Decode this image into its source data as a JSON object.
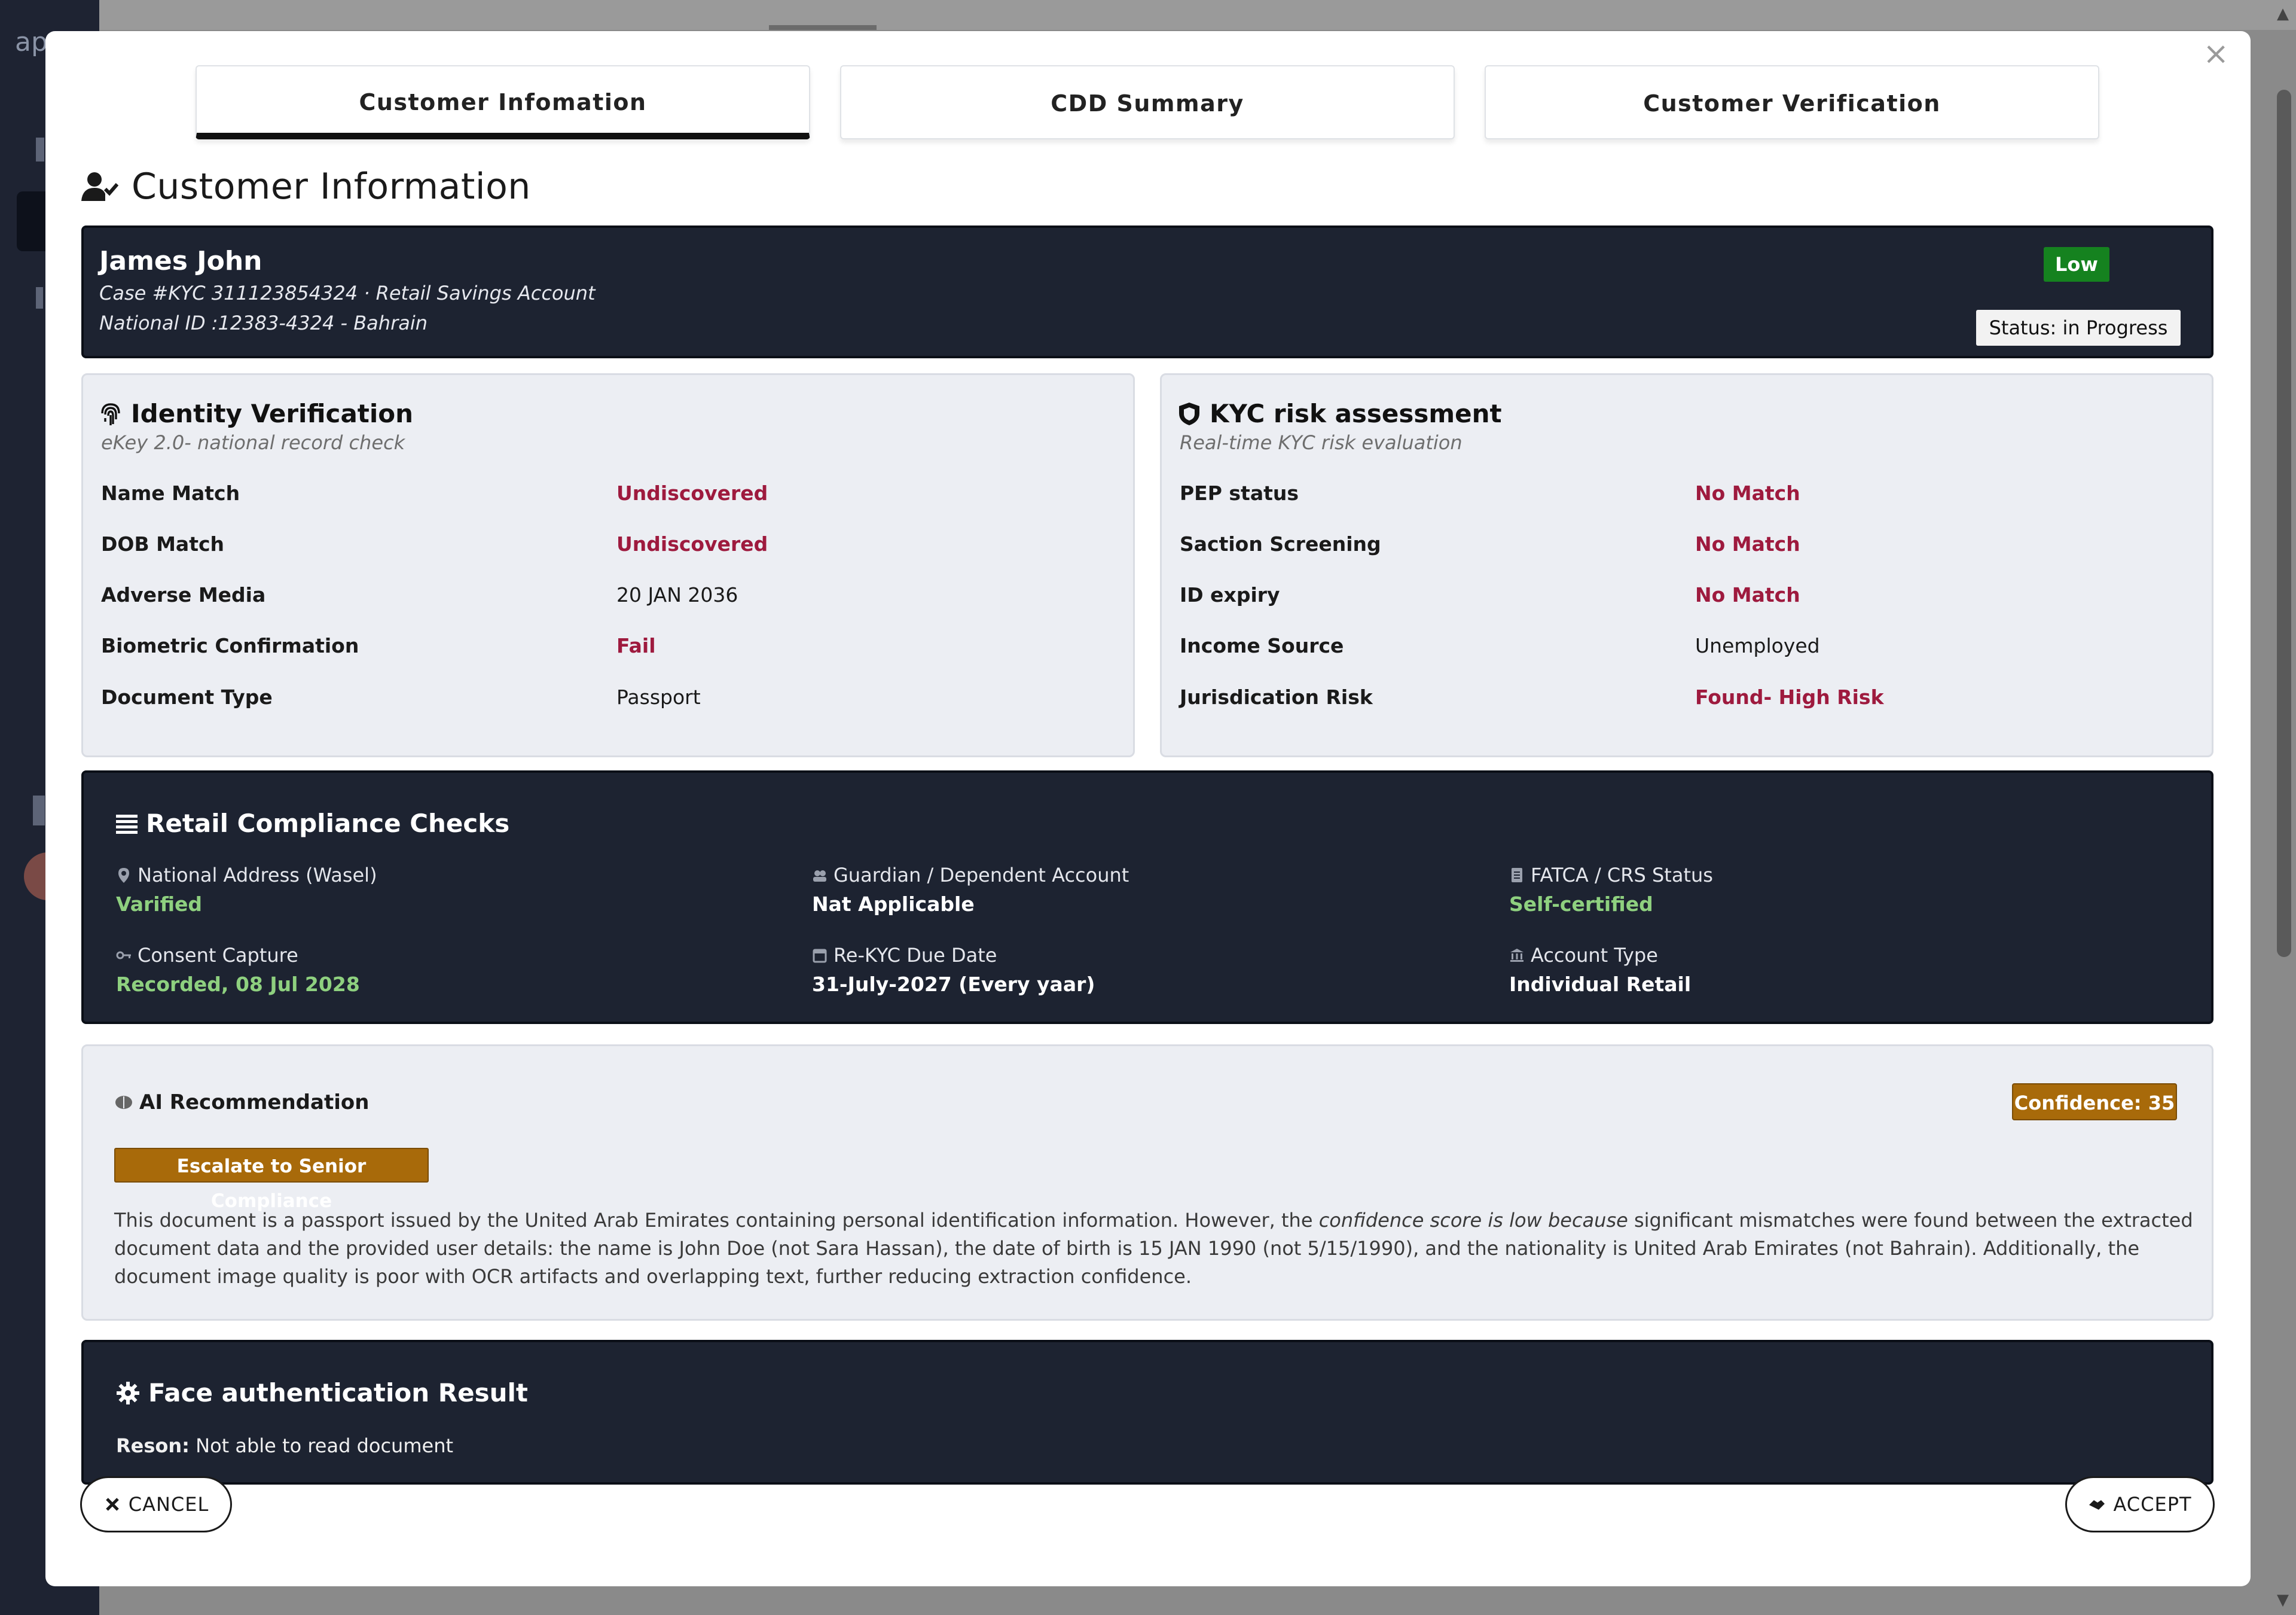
{
  "background": {
    "app_logo_fragment": "ap"
  },
  "modal": {
    "close_label": "×",
    "tabs": [
      {
        "label": "Customer Infomation",
        "active": true
      },
      {
        "label": "CDD Summary",
        "active": false
      },
      {
        "label": "Customer Verification",
        "active": false
      }
    ],
    "section_title": "Customer Information",
    "customer": {
      "name": "James John",
      "case_line": "Case #KYC 311123854324 · Retail Savings Account",
      "national_id_line": "National ID :12383-4324 - Bahrain",
      "risk_badge": "Low",
      "status": "Status: in Progress"
    },
    "identity": {
      "title": "Identity Verification",
      "subtitle": "eKey 2.0- national record check",
      "rows": [
        {
          "label": "Name Match",
          "value": "Undiscovered",
          "tone": "red"
        },
        {
          "label": "DOB Match",
          "value": "Undiscovered",
          "tone": "red"
        },
        {
          "label": "Adverse Media",
          "value": "20 JAN 2036",
          "tone": "plain"
        },
        {
          "label": "Biometric Confirmation",
          "value": "Fail",
          "tone": "red"
        },
        {
          "label": "Document Type",
          "value": "Passport",
          "tone": "plain"
        }
      ]
    },
    "kyc": {
      "title": "KYC risk assessment",
      "subtitle": "Real-time KYC risk evaluation",
      "rows": [
        {
          "label": "PEP status",
          "value": "No Match",
          "tone": "red"
        },
        {
          "label": "Saction Screening",
          "value": "No Match",
          "tone": "red"
        },
        {
          "label": "ID expiry",
          "value": "No Match",
          "tone": "red"
        },
        {
          "label": "Income Source",
          "value": "Unemployed",
          "tone": "plain"
        },
        {
          "label": "Jurisdication Risk",
          "value": "Found- High Risk",
          "tone": "red"
        }
      ]
    },
    "compliance": {
      "title": "Retail Compliance Checks",
      "items": [
        {
          "icon": "pin-icon",
          "label": "National Address (Wasel)",
          "value": "Varified",
          "tone": "green"
        },
        {
          "icon": "users-icon",
          "label": "Guardian / Dependent Account",
          "value": "Nat Applicable",
          "tone": "white"
        },
        {
          "icon": "document-icon",
          "label": "FATCA / CRS Status",
          "value": "Self-certified",
          "tone": "green"
        },
        {
          "icon": "key-icon",
          "label": "Consent Capture",
          "value": "Recorded, 08 Jul 2028",
          "tone": "green"
        },
        {
          "icon": "calendar-icon",
          "label": "Re-KYC Due Date",
          "value": "31-July-2027 (Every yaar)",
          "tone": "white"
        },
        {
          "icon": "bank-icon",
          "label": "Account Type",
          "value": "Individual Retail",
          "tone": "white"
        }
      ]
    },
    "ai": {
      "title": "AI Recommendation",
      "confidence": "Confidence: 35",
      "action": "Escalate to Senior Compliance",
      "text_a": "This document is a passport issued by the United Arab Emirates containing personal identification information. However, the ",
      "text_b": "confidence score is low because",
      "text_c": " significant mismatches were found between the extracted document data and the provided user details: the name is John Doe (not Sara Hassan), the date of birth is 15 JAN 1990 (not 5/15/1990), and the nationality is United Arab Emirates (not Bahrain). Additionally, the document image quality is poor with OCR artifacts and overlapping text, further reducing extraction confidence."
    },
    "face": {
      "title": "Face authentication Result",
      "reason_label": "Reson:",
      "reason_value": " Not able to read document"
    },
    "buttons": {
      "cancel": "CANCEL",
      "accept": "ACCEPT"
    },
    "colors": {
      "dark_panel": "#1d2331",
      "risk_red": "#9e1a3e",
      "ok_green": "#8ed07f",
      "low_badge": "#15821f",
      "amber": "#a86a0a"
    }
  }
}
